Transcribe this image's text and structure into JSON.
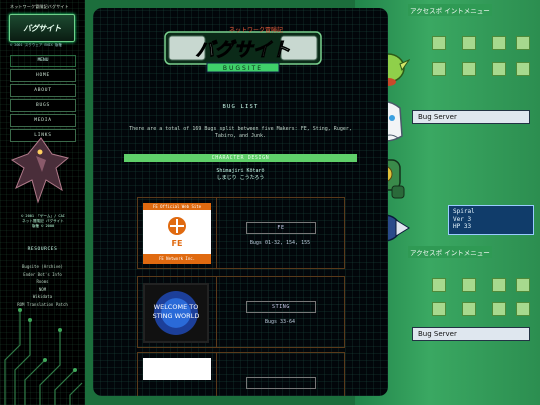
{
  "sidebar": {
    "top_title": "ネットワーク冒険記バグサイト",
    "logo_text": "バグサイト",
    "logo_sub": "© 2001 スクウェア ENIX 版権",
    "menu_label": "MENU",
    "nav": [
      "HOME",
      "ABOUT",
      "BUGS",
      "MEDIA",
      "LINKS"
    ],
    "copyright": [
      "© 2001 「ゲーム」/ CAI",
      "ネット冒険記 バグサイト",
      "版権 © 2000"
    ],
    "resources_title": "RESOURCES",
    "links": [
      "Bugsite (Archive)",
      "Ender Bot's Info",
      "Rooms",
      "NOM",
      "Wikidata",
      "ROM Translation Patch"
    ]
  },
  "main": {
    "logo_top": "ネットワーク冒険記",
    "logo_main": "バグサイト",
    "logo_sub": "BUGSITE",
    "section_title": "BUG LIST",
    "intro": "There are a total of 169 Bugs split between five Makers: FE, Sting, Ruger, Tabiro, and Junk.",
    "character_design_label": "CHARACTER DESIGN",
    "designer_romaji": "Shimajiri Kōtarō",
    "designer_kana": "しまじり こうたろう",
    "makers": [
      {
        "name": "FE",
        "bugs": "Bugs 01-32, 154, 155",
        "thumb_title": "FE Official Web Site",
        "thumb_logo": "FE",
        "thumb_footer": "FE Network Inc."
      },
      {
        "name": "STING",
        "bugs": "Bugs 33-64",
        "thumb_text": "WELCOME TO STING WORLD"
      },
      {
        "name": "",
        "bugs": ""
      }
    ]
  },
  "right": {
    "window_title_1": "アクセスポ イントメニュー",
    "window_title_2": "アクセスポ イントメニュー",
    "server_label_1": "Bug Server",
    "server_label_2": "Bug Server",
    "status_line_1": "Spiral",
    "status_line_2": "Ver   3",
    "status_line_3": "HP         33"
  }
}
